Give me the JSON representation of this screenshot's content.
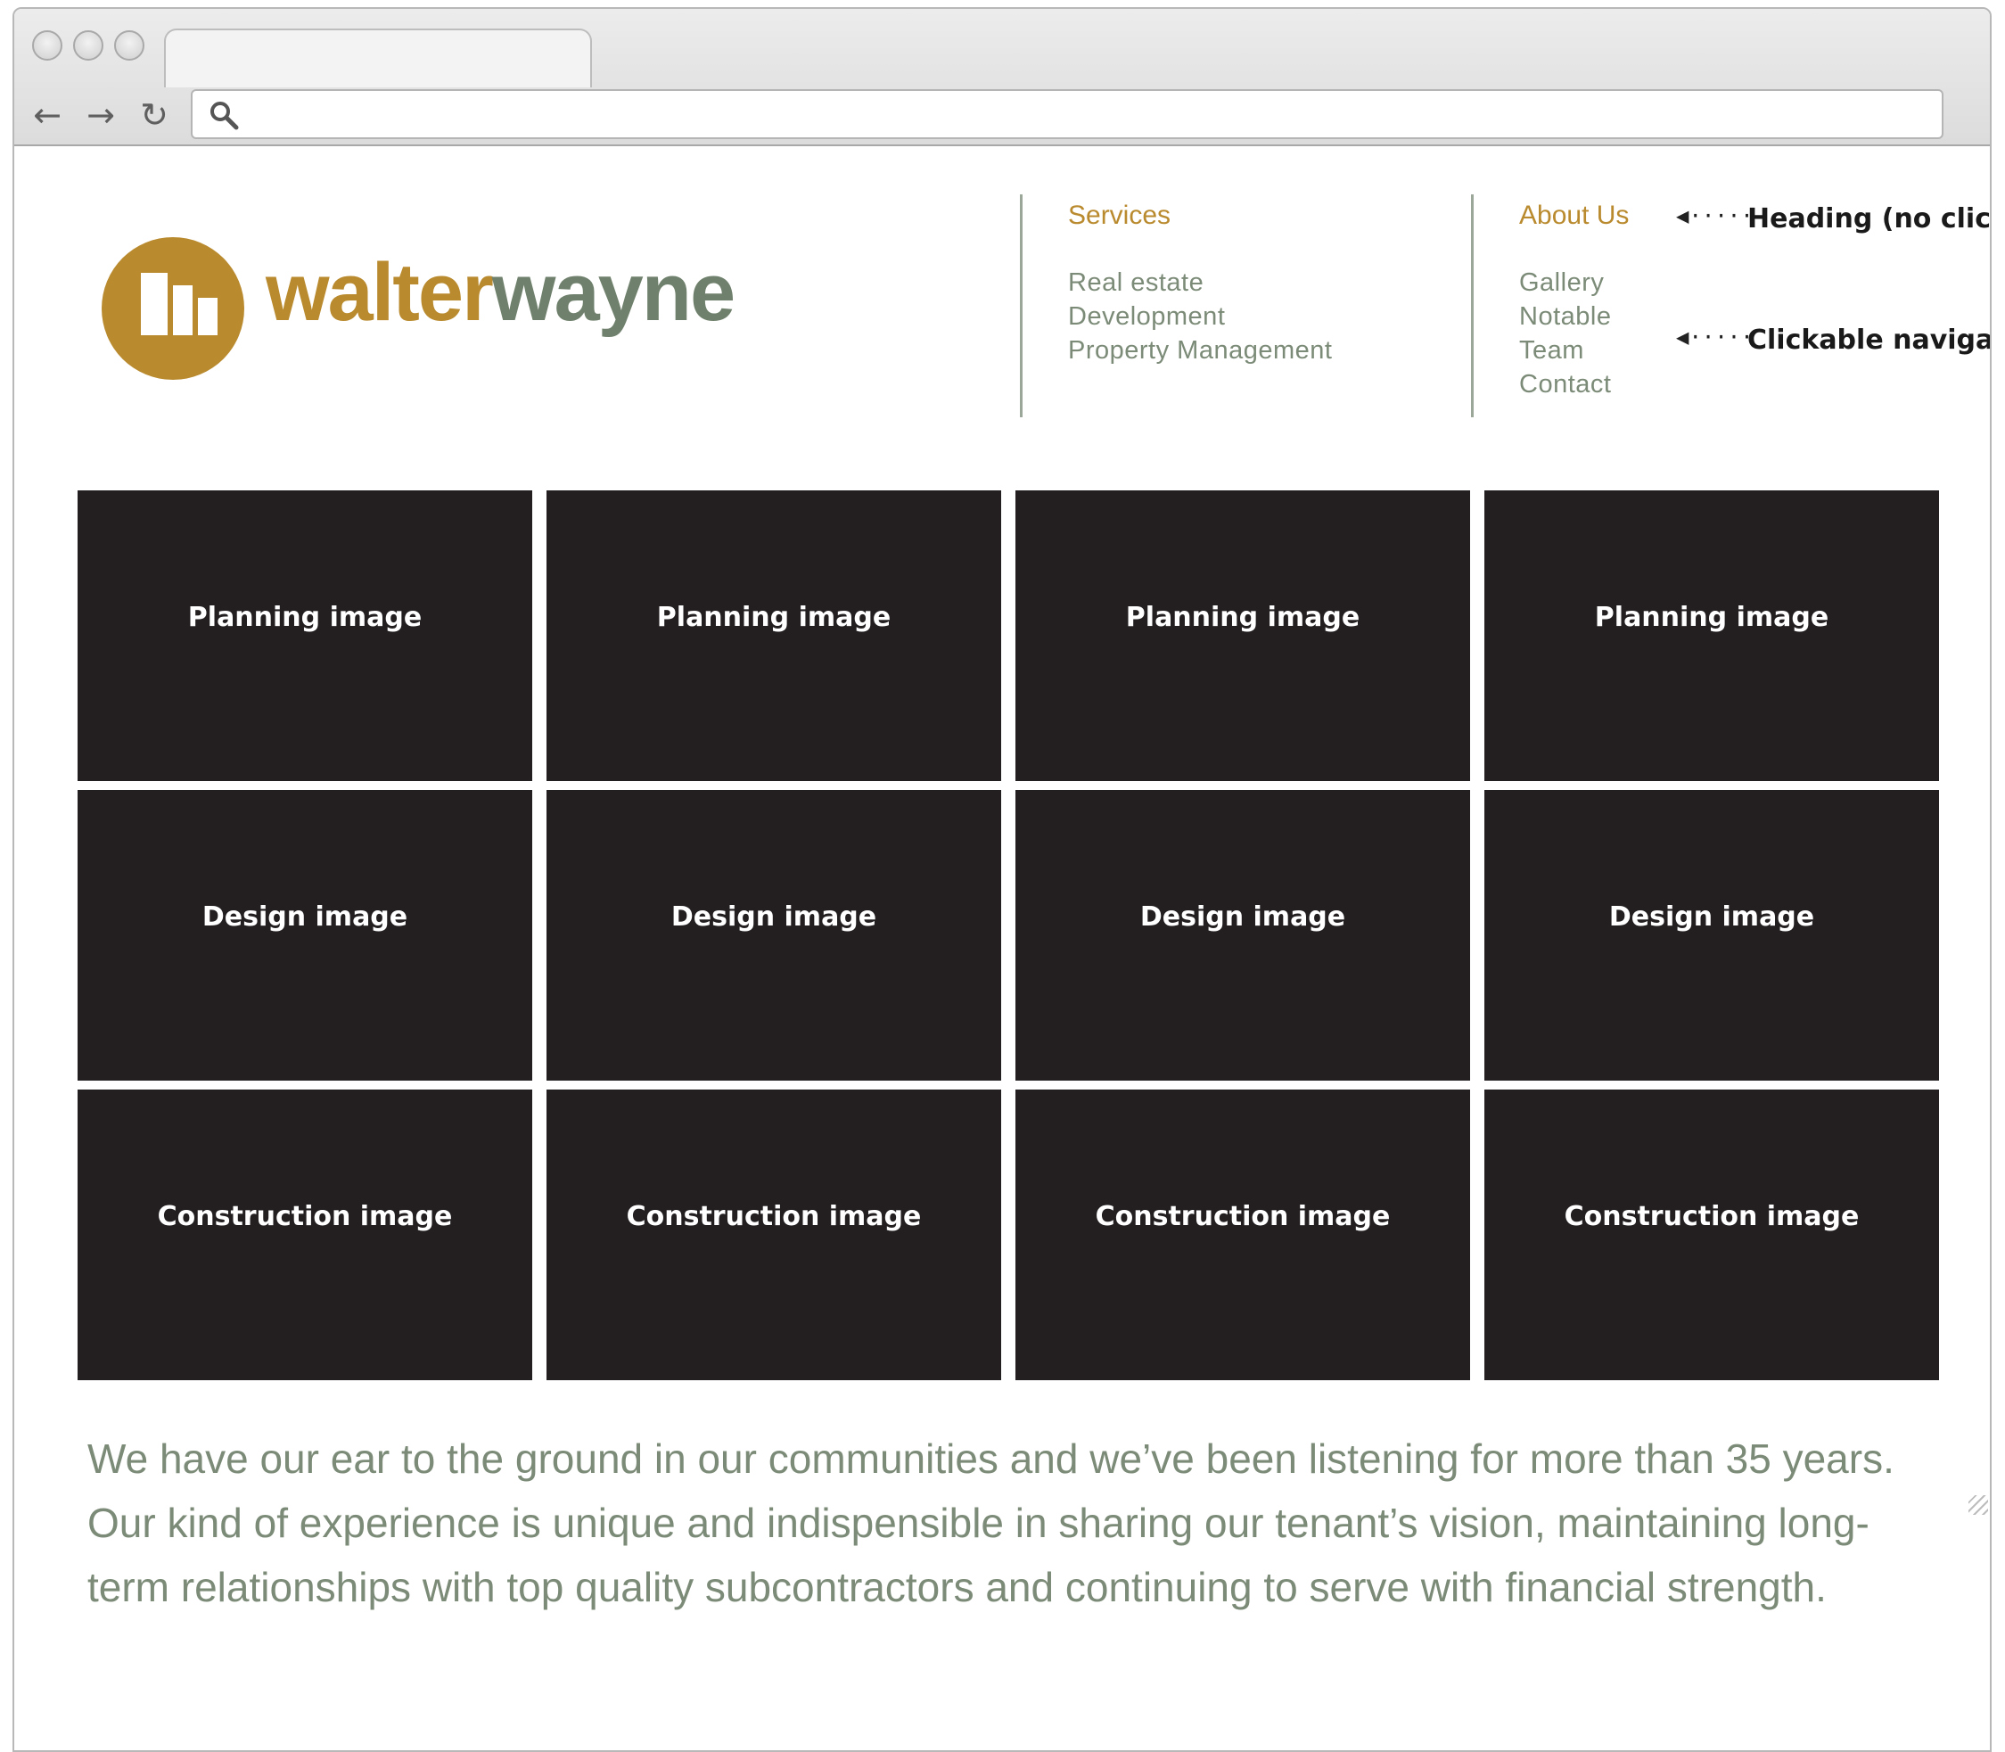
{
  "browser": {
    "url": ""
  },
  "brand": {
    "part1": "walter",
    "part2": "wayne",
    "gold": "#b98a2e",
    "green": "#6f816c"
  },
  "menu": {
    "services": {
      "heading": "Services",
      "items": [
        "Real estate",
        "Development",
        "Property Management"
      ]
    },
    "about": {
      "heading": "About Us",
      "items": [
        "Gallery",
        "Notable",
        "Team",
        "Contact"
      ]
    }
  },
  "annotations": {
    "heading_note": "Heading (no click)",
    "nav_note": "Clickable navigation"
  },
  "gallery": {
    "rows": [
      [
        "Planning image",
        "Planning image",
        "Planning image",
        "Planning image"
      ],
      [
        "Design image",
        "Design image",
        "Design image",
        "Design image"
      ],
      [
        "Construction image",
        "Construction image",
        "Construction image",
        "Construction image"
      ]
    ]
  },
  "about_text": "We have our ear to the ground in our communities and we’ve been listening for more than 35 years. Our kind of experience is unique and indispensible in sharing our tenant’s vision, maintaining long-term relationships with top quality subcontractors and continuing to serve with financial strength."
}
